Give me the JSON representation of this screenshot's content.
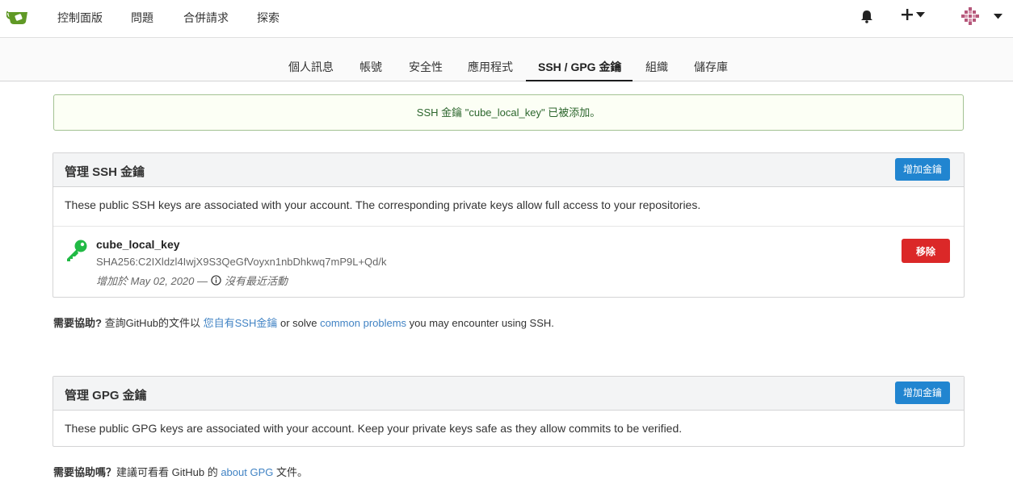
{
  "topnav": {
    "items": [
      "控制面版",
      "問題",
      "合併請求",
      "探索"
    ]
  },
  "tabs": [
    "個人訊息",
    "帳號",
    "安全性",
    "應用程式",
    "SSH / GPG 金鑰",
    "組織",
    "儲存庫"
  ],
  "flash": {
    "message": "SSH 金鑰 \"cube_local_key\" 已被添加。"
  },
  "ssh": {
    "title": "管理 SSH 金鑰",
    "add_button": "增加金鑰",
    "description": "These public SSH keys are associated with your account. The corresponding private keys allow full access to your repositories.",
    "key": {
      "name": "cube_local_key",
      "fingerprint": "SHA256:C2IXldzl4IwjX9S3QeGfVoyxn1nbDhkwq7mP9L+Qd/k",
      "added": "增加於 May 02, 2020 —",
      "activity": "沒有最近活動",
      "remove_button": "移除"
    },
    "help": {
      "prefix": "需要協助?",
      "text1": " 查詢GitHub的文件以 ",
      "link1": "您自有SSH金鑰",
      "text2": " or solve ",
      "link2": "common problems",
      "text3": " you may encounter using SSH."
    }
  },
  "gpg": {
    "title": "管理 GPG 金鑰",
    "add_button": "增加金鑰",
    "description": "These public GPG keys are associated with your account. Keep your private keys safe as they allow commits to be verified.",
    "help": {
      "prefix": "需要協助嗎？",
      "text1": "建議可看看 GitHub 的 ",
      "link1": "about GPG",
      "text2": " 文件。"
    }
  },
  "colors": {
    "primary": "#2185d0",
    "danger": "#db2828",
    "success_bg": "#fcfff5",
    "success_text": "#2c662d",
    "link": "#4183c4",
    "key_icon": "#21ba45"
  }
}
